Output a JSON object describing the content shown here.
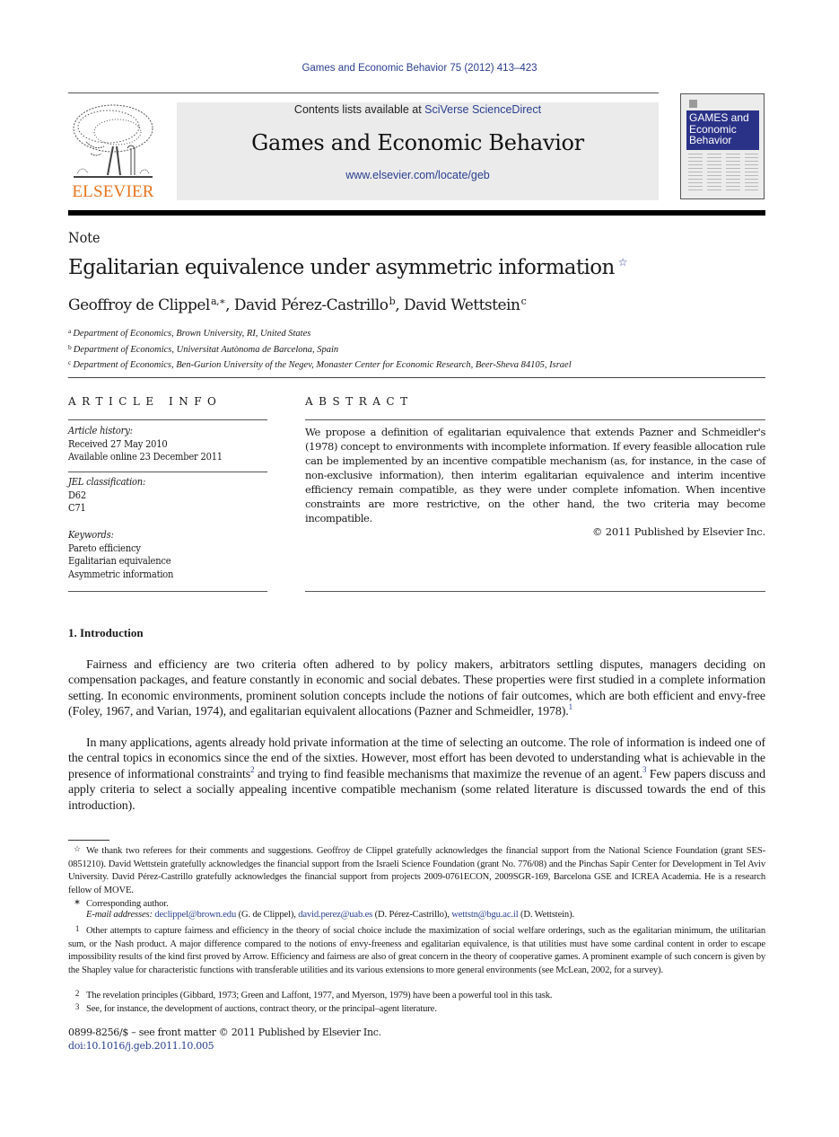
{
  "running_head": "Games and Economic Behavior 75 (2012) 413–423",
  "masthead": {
    "publisher_logo_text": "ELSEVIER",
    "contents_prefix": "Contents lists available at ",
    "contents_link": "SciVerse ScienceDirect",
    "journal_name": "Games and Economic Behavior",
    "journal_url": "www.elsevier.com/locate/geb",
    "cover_title_lines": [
      "GAMES and",
      "Economic",
      "Behavior"
    ]
  },
  "colors": {
    "link_blue": "#2a3f8f",
    "elsevier_orange": "#e8731e",
    "cover_blue": "#2a3288",
    "masthead_gray": "#ebebeb"
  },
  "article": {
    "type_label": "Note",
    "title": "Egalitarian equivalence under asymmetric information",
    "title_mark": "☆",
    "authors": [
      {
        "name": "Geoffroy de Clippel",
        "marks": "a,∗"
      },
      {
        "name": "David Pérez-Castrillo",
        "marks": "b"
      },
      {
        "name": "David Wettstein",
        "marks": "c"
      }
    ],
    "affiliations": [
      {
        "mark": "a",
        "text": "Department of Economics, Brown University, RI, United States"
      },
      {
        "mark": "b",
        "text": "Department of Economics, Universitat Autònoma de Barcelona, Spain"
      },
      {
        "mark": "c",
        "text": "Department of Economics, Ben-Gurion University of the Negev, Monaster Center for Economic Research, Beer-Sheva 84105, Israel"
      }
    ]
  },
  "article_info": {
    "heading": "ARTICLE INFO",
    "history_label": "Article history:",
    "history": [
      "Received 27 May 2010",
      "Available online 23 December 2011"
    ],
    "jel_label": "JEL classification:",
    "jel": [
      "D62",
      "C71"
    ],
    "keywords_label": "Keywords:",
    "keywords": [
      "Pareto efficiency",
      "Egalitarian equivalence",
      "Asymmetric information"
    ]
  },
  "abstract": {
    "heading": "ABSTRACT",
    "text": "We propose a definition of egalitarian equivalence that extends Pazner and Schmeidler's (1978) concept to environments with incomplete information. If every feasible allocation rule can be implemented by an incentive compatible mechanism (as, for instance, in the case of non-exclusive information), then interim egalitarian equivalence and interim incentive efficiency remain compatible, as they were under complete infomation. When incentive constraints are more restrictive, on the other hand, the two criteria may become incompatible.",
    "copyright": "© 2011 Published by Elsevier Inc."
  },
  "introduction": {
    "heading": "1.  Introduction",
    "para1": {
      "text": "Fairness and efficiency are two criteria often adhered to by policy makers, arbitrators settling disputes, managers deciding on compensation packages, and feature constantly in economic and social debates. These properties were first studied in a complete information setting. In economic environments, prominent solution concepts include the notions of fair outcomes, which are both efficient and envy-free (Foley, 1967, and Varian, 1974), and egalitarian equivalent allocations (Pazner and Schmeidler, 1978).",
      "fn": "1"
    },
    "para2": {
      "part1": "In many applications, agents already hold private information at the time of selecting an outcome. The role of information is indeed one of the central topics in economics since the end of the sixties. However, most effort has been devoted to understanding what is achievable in the presence of informational constraints",
      "fn_a": "2",
      "part2": " and trying to find feasible mechanisms that maximize the revenue of an agent.",
      "fn_b": "3",
      "part3": " Few papers discuss and apply criteria to select a socially appealing incentive compatible mechanism (some related literature is discussed towards the end of this introduction)."
    }
  },
  "footnotes": {
    "star": {
      "mark": "☆",
      "text": "We thank two referees for their comments and suggestions. Geoffroy de Clippel gratefully acknowledges the financial support from the National Science Foundation (grant SES-0851210). David Wettstein gratefully acknowledges the financial support from the Israeli Science Foundation (grant No. 776/08) and the Pinchas Sapir Center for Development in Tel Aviv University. David Pérez-Castrillo gratefully acknowledges the financial support from projects 2009-0761ECON, 2009SGR-169, Barcelona GSE and ICREA Academia. He is a research fellow of MOVE."
    },
    "corresponding": {
      "mark": "∗",
      "text": "Corresponding author."
    },
    "emails": {
      "label": "E-mail addresses:",
      "items": [
        {
          "email": "declippel@brown.edu",
          "who": " (G. de Clippel), "
        },
        {
          "email": "david.perez@uab.es",
          "who": " (D. Pérez-Castrillo), "
        },
        {
          "email": "wettstn@bgu.ac.il",
          "who": " (D. Wettstein)."
        }
      ]
    },
    "fn1": {
      "mark": "1",
      "text": "Other attempts to capture fairness and efficiency in the theory of social choice include the maximization of social welfare orderings, such as the egalitarian minimum, the utilitarian sum, or the Nash product. A major difference compared to the notions of envy-freeness and egalitarian equivalence, is that utilities must have some cardinal content in order to escape impossibility results of the kind first proved by Arrow. Efficiency and fairness are also of great concern in the theory of cooperative games. A prominent example of such concern is given by the Shapley value for characteristic functions with transferable utilities and its various extensions to more general environments (see McLean, 2002, for a survey)."
    },
    "fn2": {
      "mark": "2",
      "text": "The revelation principles (Gibbard, 1973; Green and Laffont, 1977, and Myerson, 1979) have been a powerful tool in this task."
    },
    "fn3": {
      "mark": "3",
      "text": "See, for instance, the development of auctions, contract theory, or the principal–agent literature."
    }
  },
  "front_matter": {
    "issn_line": "0899-8256/$ – see front matter  © 2011 Published by Elsevier Inc.",
    "doi": "doi:10.1016/j.geb.2011.10.005"
  }
}
